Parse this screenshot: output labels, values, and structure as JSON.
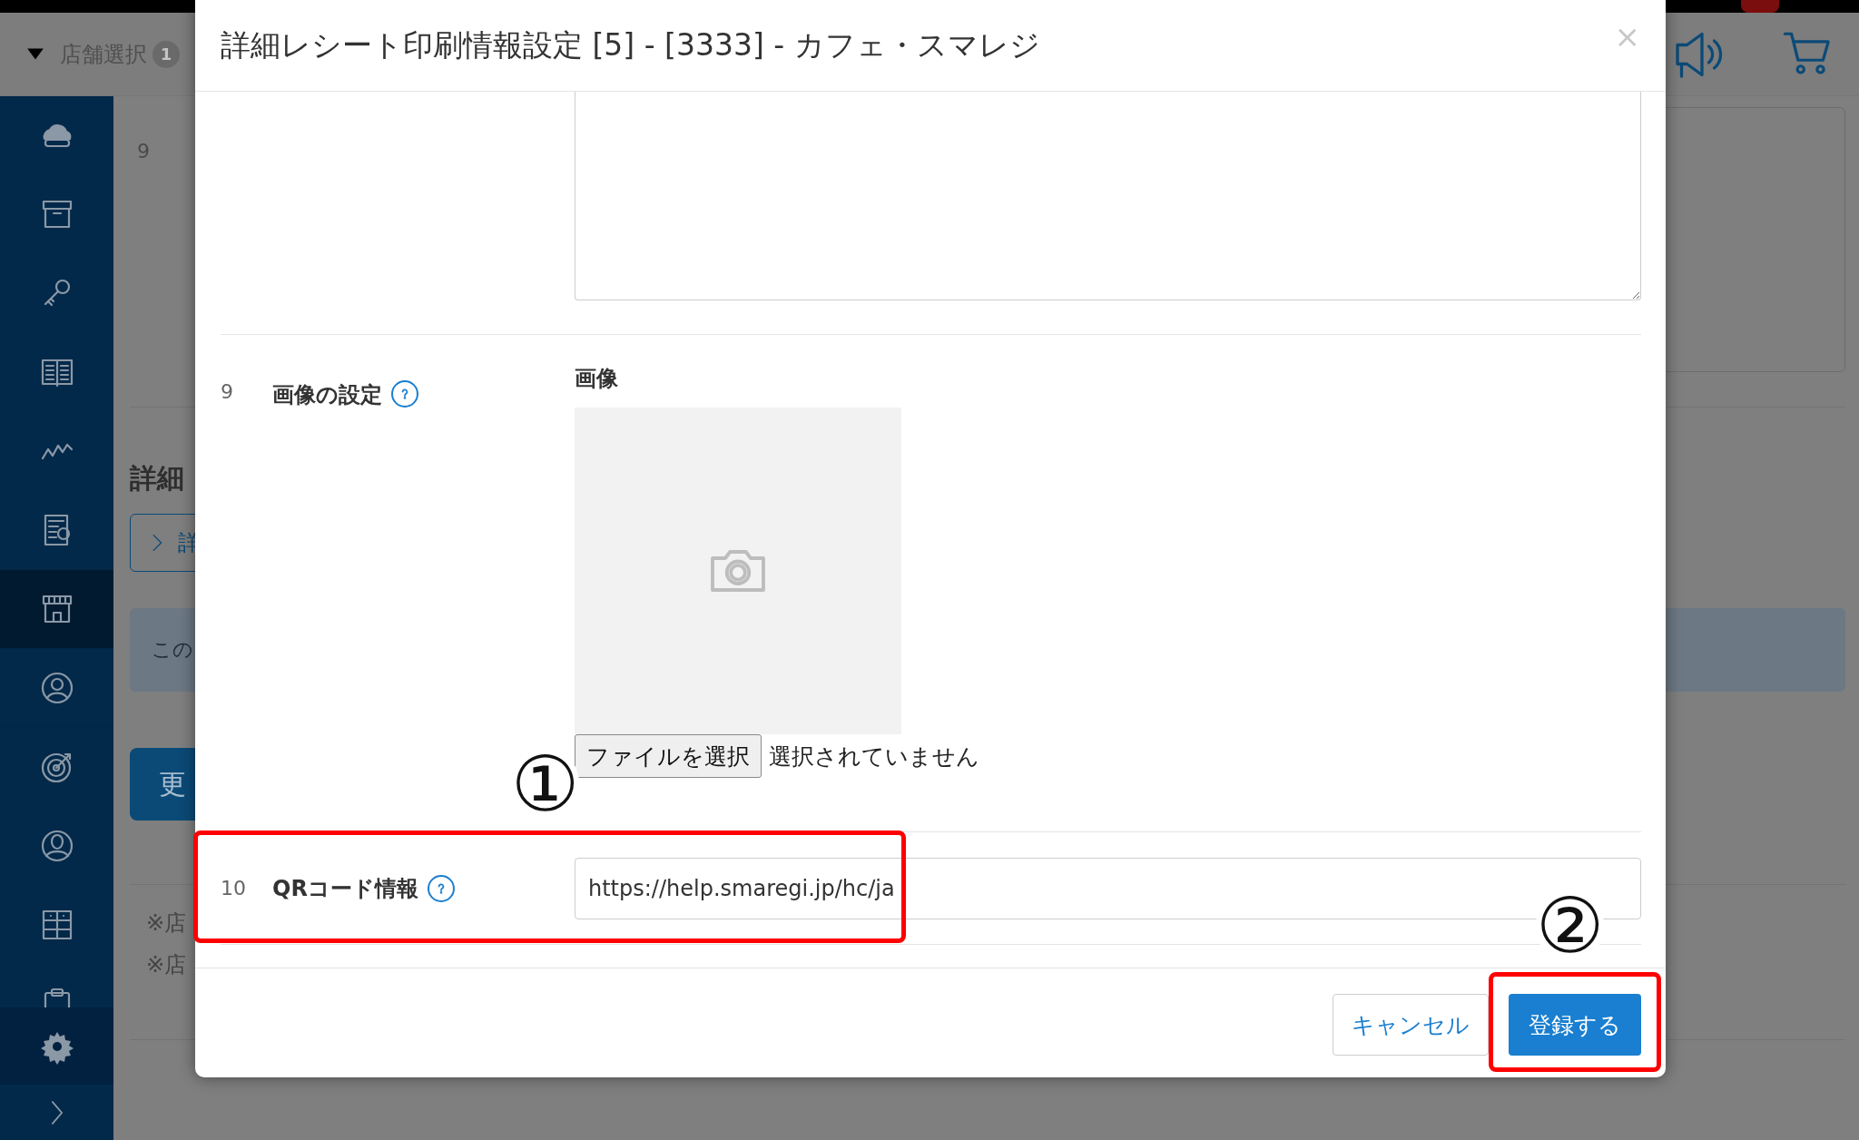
{
  "header": {
    "store_select": "店舗選択",
    "store_count": "1"
  },
  "sidebar": {
    "items": [
      {
        "kind": "cloud",
        "selected": false
      },
      {
        "kind": "box",
        "selected": false
      },
      {
        "kind": "key",
        "selected": false
      },
      {
        "kind": "book",
        "selected": false
      },
      {
        "kind": "chart",
        "selected": false
      },
      {
        "kind": "report",
        "selected": false
      },
      {
        "kind": "store",
        "selected": true
      },
      {
        "kind": "user-circle",
        "selected": false
      },
      {
        "kind": "target",
        "selected": false
      },
      {
        "kind": "person",
        "selected": false
      },
      {
        "kind": "grid",
        "selected": false
      },
      {
        "kind": "clipboard",
        "selected": false
      }
    ]
  },
  "background": {
    "row_number": "9",
    "heading": "詳細",
    "link_button": "詳",
    "notice": "この",
    "update_button": "更",
    "notes": [
      "※店",
      "※店"
    ]
  },
  "dialog": {
    "title": "詳細レシート印刷情報設定 [5] - [3333] - カフェ・スマレジ",
    "close": "×",
    "rows": [
      {
        "kind": "textarea"
      },
      {
        "kind": "image",
        "number": "9",
        "label": "画像の設定",
        "field_label": "画像",
        "file_button": "ファイルを選択",
        "file_status": "選択されていません"
      },
      {
        "kind": "text",
        "number": "10",
        "label": "QRコード情報",
        "value": "https://help.smaregi.jp/hc/ja"
      }
    ],
    "buttons": {
      "cancel": "キャンセル",
      "submit": "登録する"
    }
  },
  "annotations": [
    {
      "mark": "①"
    },
    {
      "mark": "②"
    }
  ]
}
